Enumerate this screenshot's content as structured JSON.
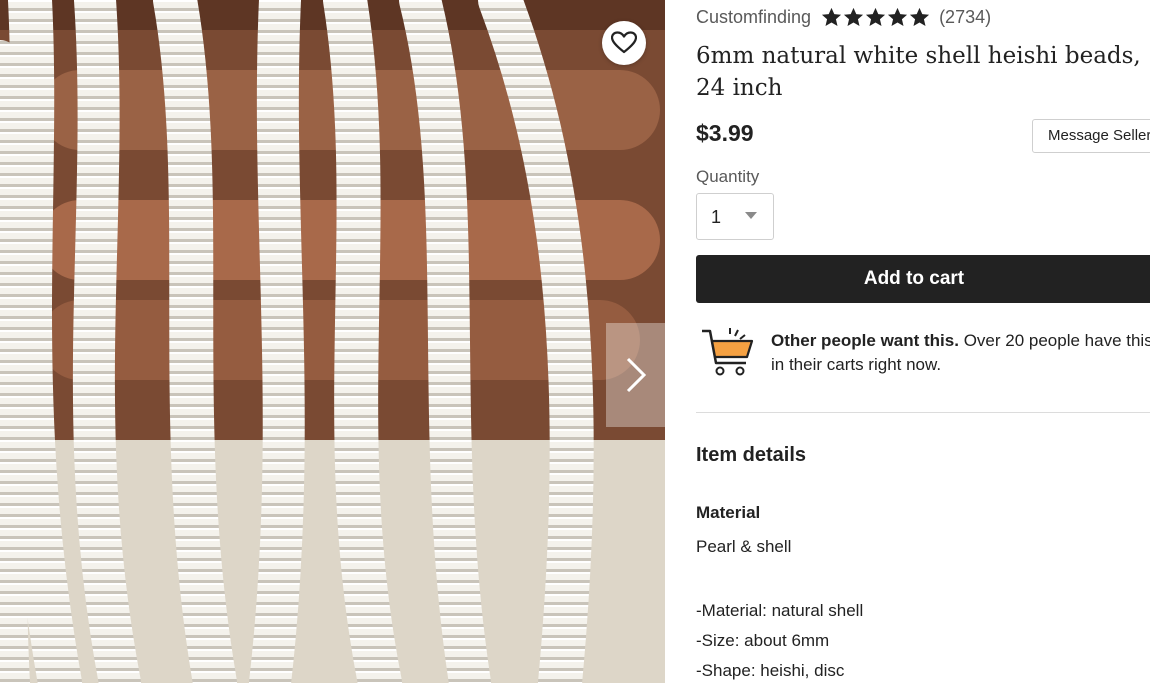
{
  "listing": {
    "shop_name": "Customfinding",
    "rating_stars": 5,
    "review_count": "(2734)",
    "title": "6mm natural white shell heishi beads, 24 inch",
    "price": "$3.99",
    "message_button": "Message Seller"
  },
  "quantity": {
    "label": "Quantity",
    "selected": "1"
  },
  "add_to_cart": "Add to cart",
  "demand_notice": {
    "bold": "Other people want this.",
    "text": " Over 20 people have this in their carts right now."
  },
  "item_details": {
    "heading": "Item details",
    "material_label": "Material",
    "material_value": "Pearl & shell",
    "description_lines": [
      "-Material: natural shell",
      "-Size: about 6mm",
      "-Shape: heishi, disc"
    ]
  },
  "icons": {
    "favorite": "heart-icon",
    "next": "chevron-right-icon",
    "cart": "cart-icon",
    "star": "star-icon",
    "caret": "caret-down-icon"
  },
  "colors": {
    "button_bg": "#222222",
    "cart_fill": "#f5a142",
    "muted_text": "#595959"
  }
}
